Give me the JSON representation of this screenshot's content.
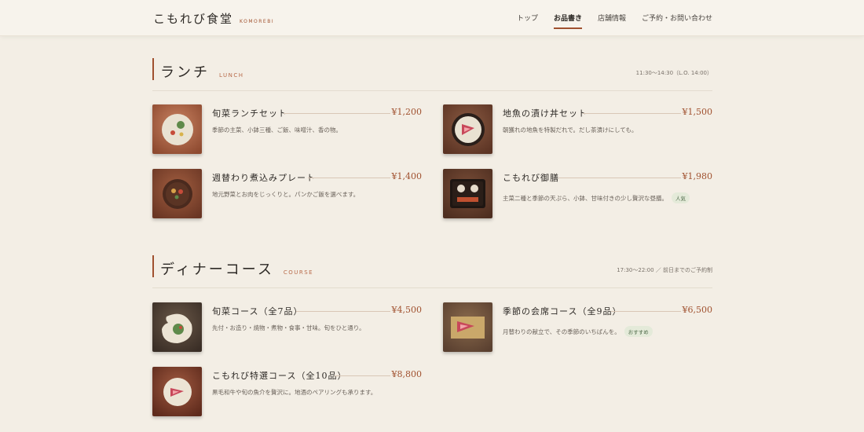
{
  "header": {
    "logo": "こもれび食堂",
    "logo_sub": "KOMOREBI",
    "nav": [
      {
        "label": "トップ",
        "active": false
      },
      {
        "label": "お品書き",
        "active": true
      },
      {
        "label": "店舗情報",
        "active": false
      },
      {
        "label": "ご予約・お問い合わせ",
        "active": false
      }
    ]
  },
  "lunch": {
    "title": "ランチ",
    "subtitle": "LUNCH",
    "hours": "11:30〜14:30（L.O. 14:00）",
    "items": [
      {
        "name": "旬菜ランチセット",
        "price": "¥1,200",
        "desc": "季節の主菜、小鉢三種、ご飯、味噌汁、香の物。",
        "badge": ""
      },
      {
        "name": "地魚の漬け丼セット",
        "price": "¥1,500",
        "desc": "朝獲れの地魚を特製だれで。だし茶漬けにしても。",
        "badge": ""
      },
      {
        "name": "週替わり煮込みプレート",
        "price": "¥1,400",
        "desc": "地元野菜とお肉をじっくりと。パンかご飯を選べます。",
        "badge": ""
      },
      {
        "name": "こもれび御膳",
        "price": "¥1,980",
        "desc": "主菜二種と季節の天ぷら、小鉢、甘味付きの少し贅沢な昼膳。",
        "badge": "人気"
      }
    ]
  },
  "dinner": {
    "title": "ディナーコース",
    "subtitle": "COURSE",
    "hours": "17:30〜22:00 ／ 前日までのご予約制",
    "items": [
      {
        "name": "旬菜コース（全7品）",
        "price": "¥4,500",
        "desc": "先付・お造り・焼物・煮物・食事・甘味。旬をひと通り。",
        "badge": ""
      },
      {
        "name": "季節の会席コース（全9品）",
        "price": "¥6,500",
        "desc": "月替わりの献立で、その季節のいちばんを。",
        "badge": "おすすめ"
      },
      {
        "name": "こもれび特選コース（全10品）",
        "price": "¥8,800",
        "desc": "黒毛和牛や旬の魚介を贅沢に。地酒のペアリングも承ります。",
        "badge": ""
      }
    ]
  },
  "colors": {
    "accent": "#a0512f",
    "background": "#f3eee5",
    "badge_bg": "#e4ead9",
    "badge_text": "#4f6b4a"
  }
}
